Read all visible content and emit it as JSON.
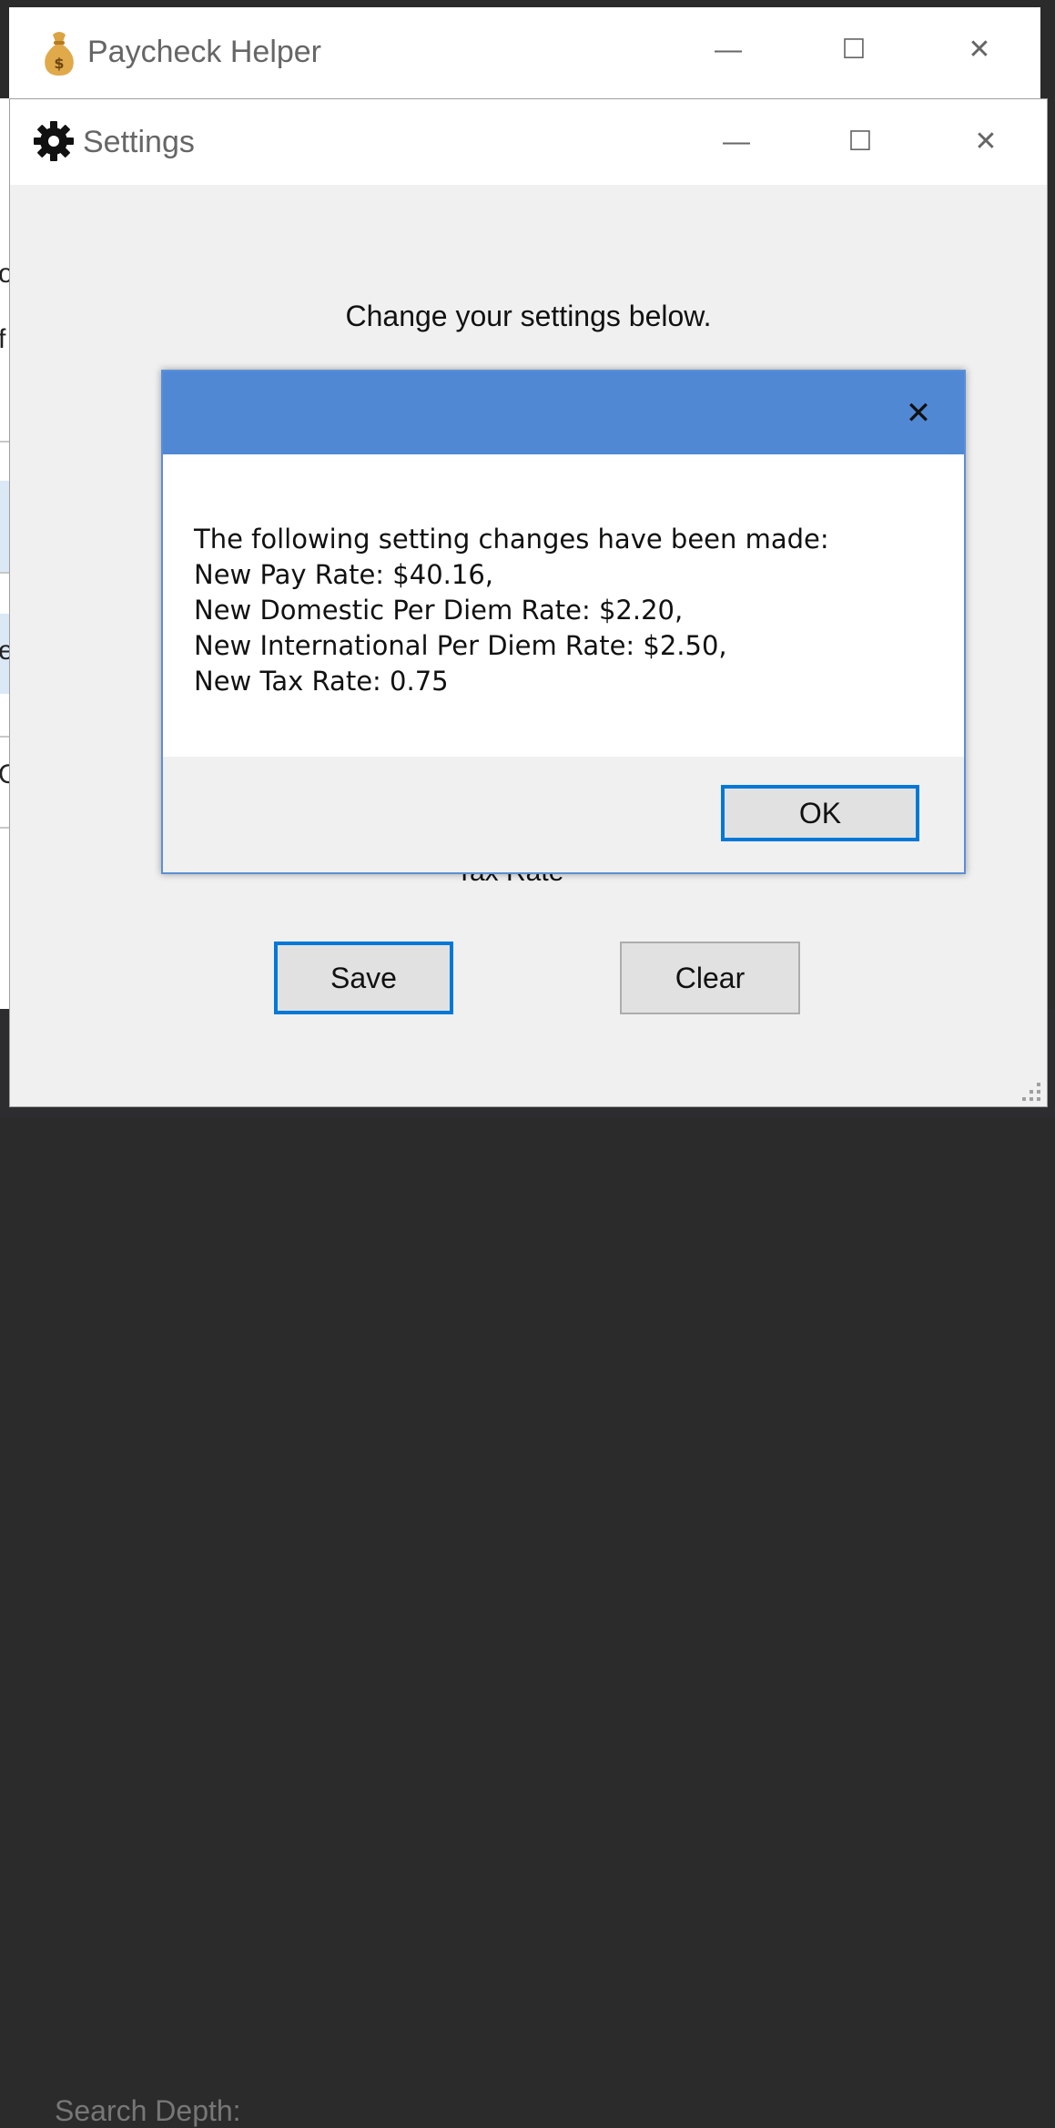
{
  "background_window": {
    "title": "Paycheck Helper",
    "app_icon": "money-bag-icon",
    "minimize": "—",
    "maximize": "☐",
    "close": "✕"
  },
  "left_strip_chars": [
    "o",
    "f",
    "e",
    "O"
  ],
  "background_text": "Search Depth:",
  "settings_window": {
    "title": "Settings",
    "icon": "gear-icon",
    "minimize": "—",
    "maximize": "☐",
    "close": "✕",
    "instruction": "Change your settings below.",
    "partial_label": "Tax Rate",
    "save_label": "Save",
    "clear_label": "Clear"
  },
  "message_box": {
    "close": "✕",
    "lines": [
      "The following setting changes have been made:",
      "New Pay Rate: $40.16,",
      "New Domestic Per Diem Rate: $2.20,",
      "New International Per Diem Rate: $2.50,",
      "New Tax Rate: 0.75"
    ],
    "ok_label": "OK"
  },
  "colors": {
    "accent": "#0078d7",
    "dialog_titlebar": "#5088d4",
    "window_bg": "#f0f0f0"
  }
}
